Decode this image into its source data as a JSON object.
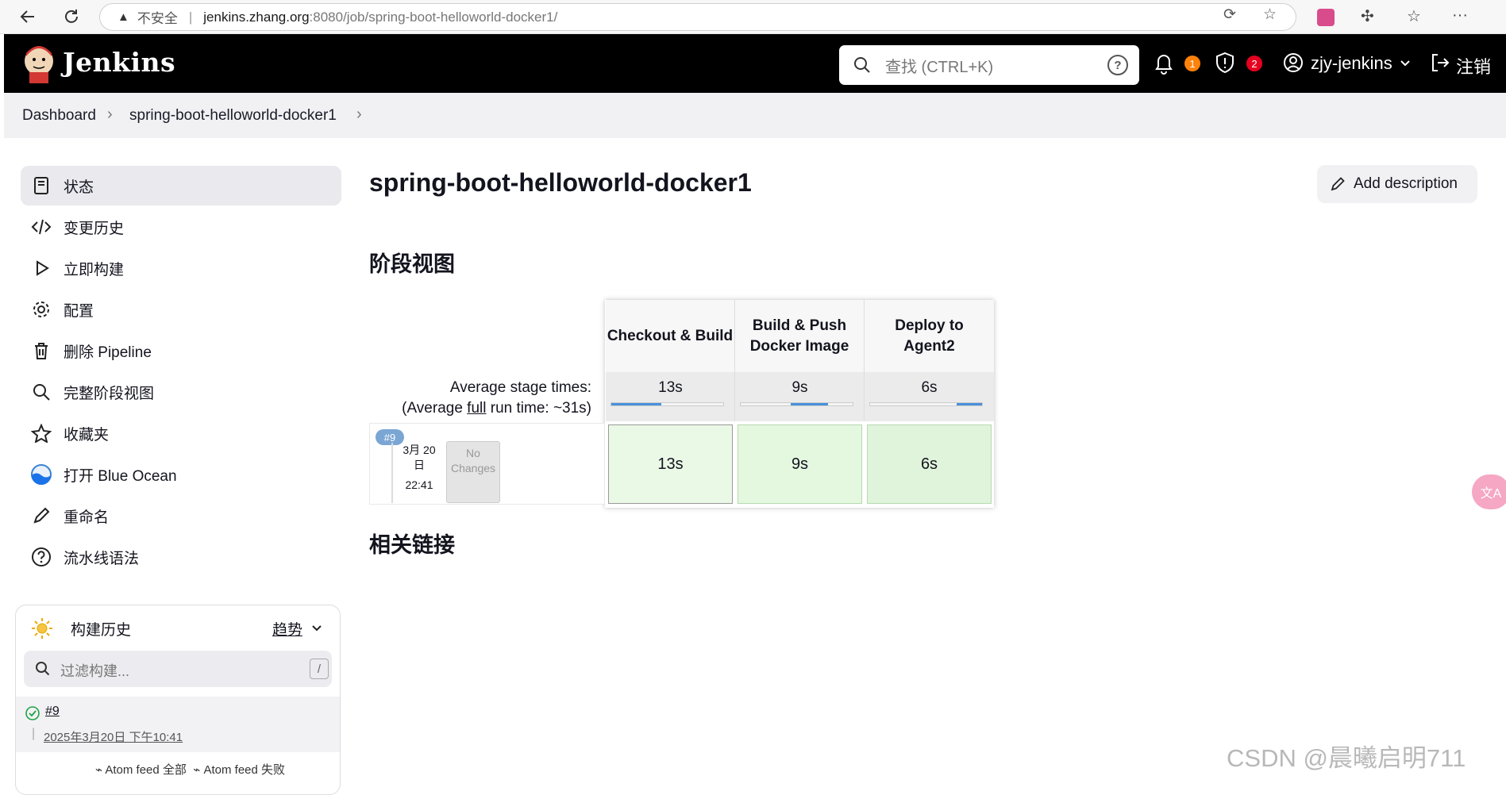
{
  "browser": {
    "security_label": "不安全",
    "url_host": "jenkins.zhang.org",
    "url_rest": ":8080/job/spring-boot-helloworld-docker1/"
  },
  "header": {
    "brand": "Jenkins",
    "search_placeholder": "查找 (CTRL+K)",
    "notifications_count": "1",
    "security_count": "2",
    "user": "zjy-jenkins",
    "logout": "注销"
  },
  "breadcrumb": {
    "items": [
      "Dashboard",
      "spring-boot-helloworld-docker1"
    ]
  },
  "sidebar": {
    "items": [
      {
        "label": "状态",
        "icon": "document-icon"
      },
      {
        "label": "变更历史",
        "icon": "code-icon"
      },
      {
        "label": "立即构建",
        "icon": "play-icon"
      },
      {
        "label": "配置",
        "icon": "gear-icon"
      },
      {
        "label": "删除 Pipeline",
        "icon": "trash-icon"
      },
      {
        "label": "完整阶段视图",
        "icon": "search-icon"
      },
      {
        "label": "收藏夹",
        "icon": "star-icon"
      },
      {
        "label": "打开 Blue Ocean",
        "icon": "blue-ocean-icon"
      },
      {
        "label": "重命名",
        "icon": "pencil-icon"
      },
      {
        "label": "流水线语法",
        "icon": "help-icon"
      }
    ]
  },
  "build_history": {
    "title": "构建历史",
    "trend": "趋势",
    "filter_placeholder": "过滤构建...",
    "filter_shortcut": "/",
    "builds": [
      {
        "number": "#9",
        "date": "2025年3月20日 下午10:41",
        "status": "success"
      }
    ],
    "feed_all": "Atom feed 全部",
    "feed_failed": "Atom feed 失败"
  },
  "main": {
    "title": "spring-boot-helloworld-docker1",
    "add_description": "Add description",
    "stage_view_heading": "阶段视图",
    "related_links_heading": "相关链接"
  },
  "stage_view": {
    "avg_label_line1": "Average stage times:",
    "avg_label_line2_pre": "(Average ",
    "avg_label_line2_link": "full",
    "avg_label_line2_post": " run time: ~31s)",
    "stages": [
      {
        "name": "Checkout & Build",
        "avg": "13s",
        "bar_start": 0.0,
        "bar_fraction": 0.45
      },
      {
        "name": "Build & Push Docker Image",
        "avg": "9s",
        "bar_start": 0.45,
        "bar_fraction": 0.33
      },
      {
        "name": "Deploy to Agent2",
        "avg": "6s",
        "bar_start": 0.77,
        "bar_fraction": 0.23
      }
    ],
    "run": {
      "badge": "#9",
      "date_line1": "3月 20",
      "date_line2": "日",
      "time": "22:41",
      "changes": "No Changes",
      "durations": [
        "13s",
        "9s",
        "6s"
      ]
    }
  },
  "watermark": "CSDN @晨曦启明711",
  "colors": {
    "header_bg": "#000000",
    "success_cell": "#e6f7e3",
    "progress_blue": "#4a90d9",
    "notify_badge": "#fe820a",
    "security_badge": "#e6001f"
  }
}
